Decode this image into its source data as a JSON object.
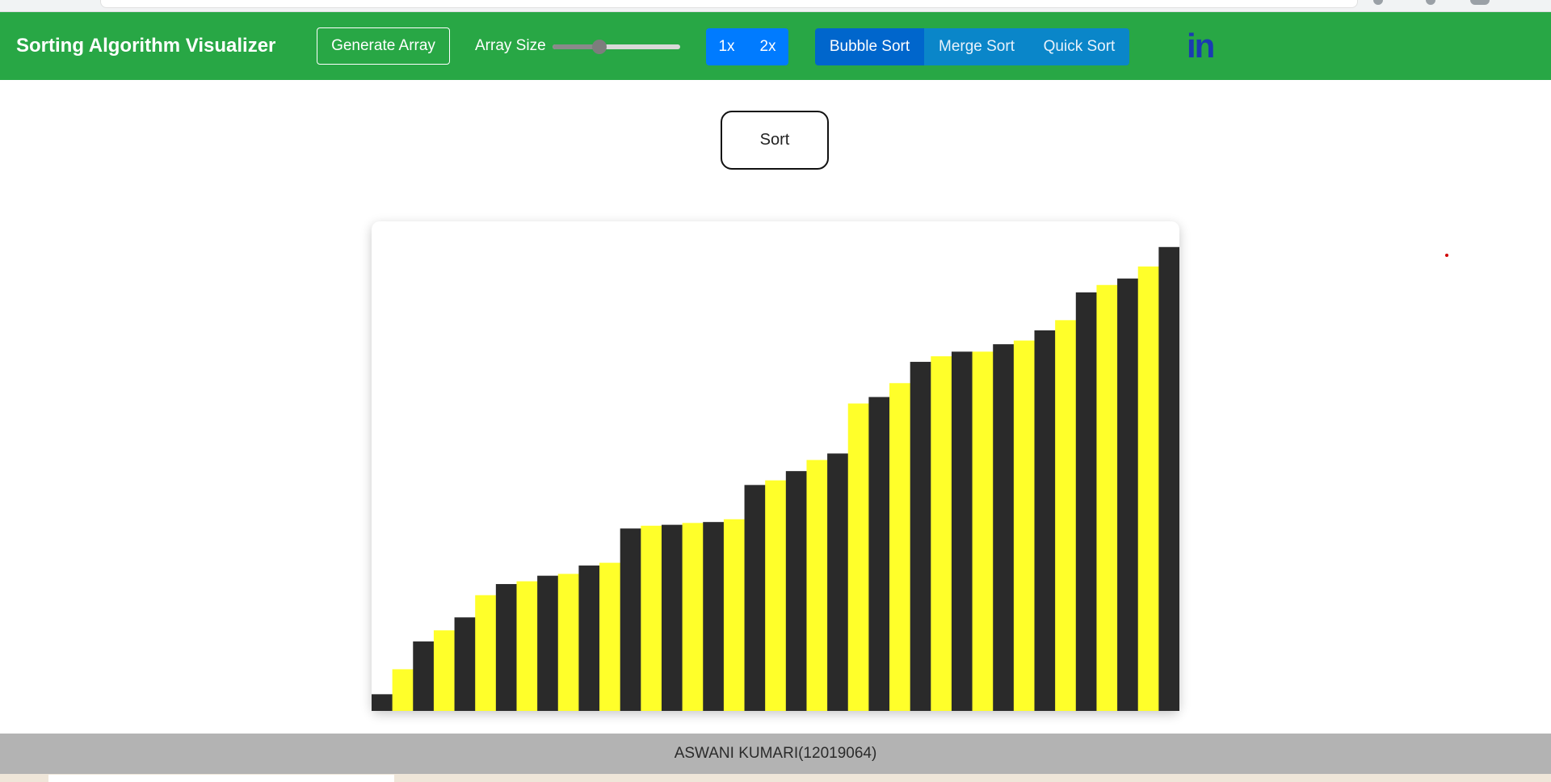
{
  "navbar": {
    "brand": "Sorting Algorithm Visualizer",
    "generate_label": "Generate Array",
    "array_size_label": "Array Size",
    "array_size_level": 0.37,
    "speeds": [
      "1x",
      "2x"
    ],
    "algorithms": [
      "Bubble Sort",
      "Merge Sort",
      "Quick Sort"
    ],
    "active_algorithm": "Bubble Sort",
    "linkedin_text": "in"
  },
  "sort_label": "Sort",
  "footer_text": "ASWANI KUMARI(12019064)",
  "colors": {
    "navbar": "#28a745",
    "active_algorithm": "#0066cc",
    "speed_button": "#007bff",
    "bar_dark": "#2a2a2a",
    "bar_yellow": "#ffff2a",
    "footer": "#b3b3b3"
  },
  "chart_data": {
    "type": "bar",
    "values": [
      18,
      45,
      75,
      87,
      101,
      125,
      137,
      140,
      146,
      148,
      157,
      160,
      197,
      200,
      201,
      203,
      204,
      207,
      244,
      249,
      259,
      271,
      278,
      332,
      339,
      354,
      377,
      383,
      388,
      388,
      396,
      400,
      411,
      422,
      452,
      460,
      467,
      480,
      501
    ],
    "colors": [
      "dark",
      "yellow",
      "dark",
      "yellow",
      "dark",
      "yellow",
      "dark",
      "yellow",
      "dark",
      "yellow",
      "dark",
      "yellow",
      "dark",
      "yellow",
      "dark",
      "yellow",
      "dark",
      "yellow",
      "dark",
      "yellow",
      "dark",
      "yellow",
      "dark",
      "yellow",
      "dark",
      "yellow",
      "dark",
      "yellow",
      "dark",
      "yellow",
      "dark",
      "yellow",
      "dark",
      "yellow",
      "dark",
      "yellow",
      "dark",
      "yellow",
      "dark"
    ],
    "ylim": [
      0,
      520
    ],
    "grid": false,
    "legend": "none"
  }
}
